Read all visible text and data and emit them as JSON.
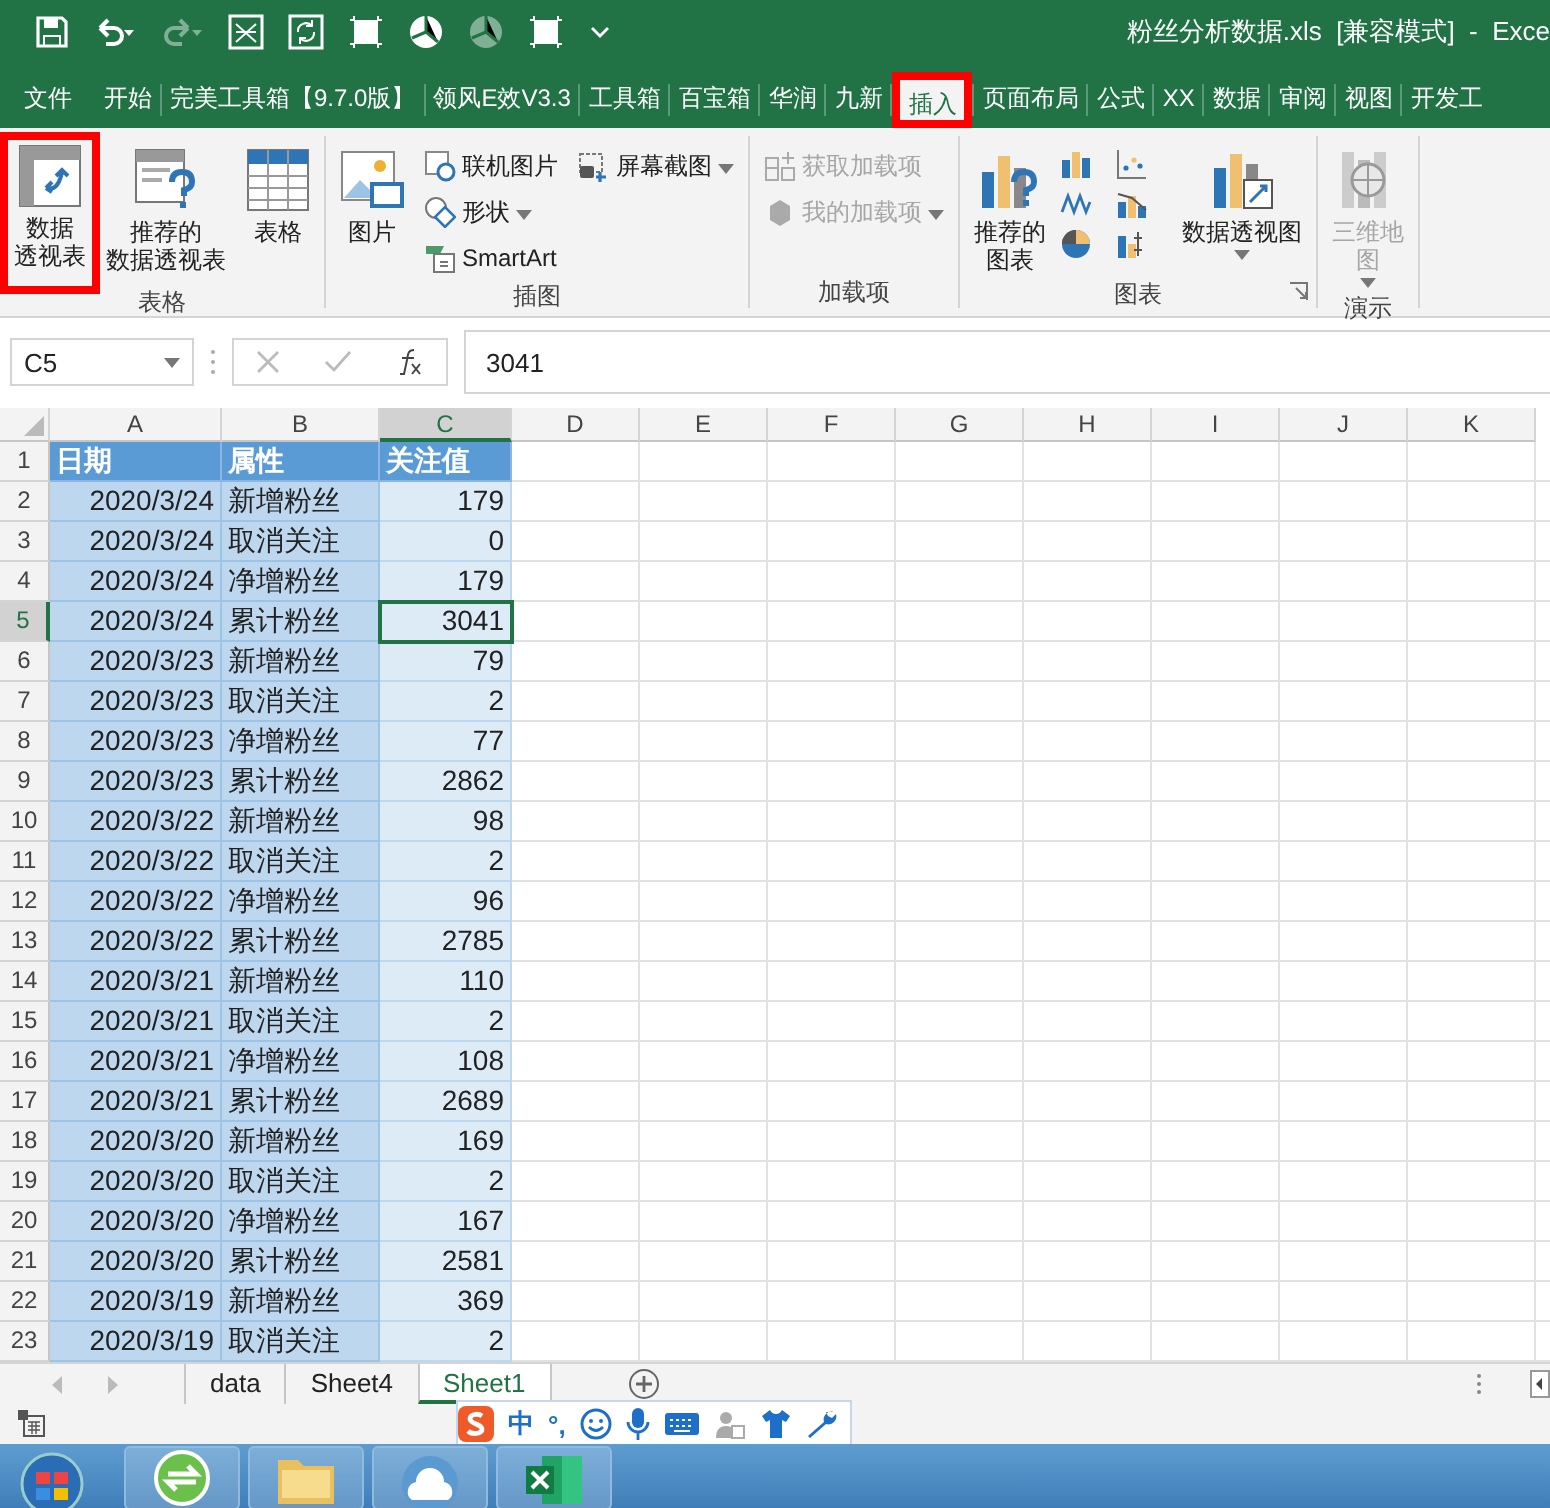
{
  "title_bar": {
    "title": "粉丝分析数据.xls  [兼容模式]  -  Exce"
  },
  "ribbon_tabs": [
    {
      "label": "文件",
      "selected": false,
      "annotated": false
    },
    {
      "label": "开始",
      "selected": false,
      "annotated": false
    },
    {
      "label": "完美工具箱【9.7.0版】",
      "selected": false,
      "annotated": false
    },
    {
      "label": "领风E效V3.3",
      "selected": false,
      "annotated": false
    },
    {
      "label": "工具箱",
      "selected": false,
      "annotated": false
    },
    {
      "label": "百宝箱",
      "selected": false,
      "annotated": false
    },
    {
      "label": "华润",
      "selected": false,
      "annotated": false
    },
    {
      "label": "九新",
      "selected": false,
      "annotated": false
    },
    {
      "label": "插入",
      "selected": true,
      "annotated": true
    },
    {
      "label": "页面布局",
      "selected": false,
      "annotated": false
    },
    {
      "label": "公式",
      "selected": false,
      "annotated": false
    },
    {
      "label": "XX",
      "selected": false,
      "annotated": false
    },
    {
      "label": "数据",
      "selected": false,
      "annotated": false
    },
    {
      "label": "审阅",
      "selected": false,
      "annotated": false
    },
    {
      "label": "视图",
      "selected": false,
      "annotated": false
    },
    {
      "label": "开发工",
      "selected": false,
      "annotated": false
    }
  ],
  "ribbon_groups": [
    {
      "label": "表格",
      "columns": [
        [
          {
            "kind": "large",
            "label_lines": [
              "数据",
              "透视表"
            ],
            "dropdown": false,
            "disabled": false,
            "annotated": true
          }
        ],
        [
          {
            "kind": "large",
            "label_lines": [
              "推荐的",
              "数据透视表"
            ],
            "dropdown": false,
            "disabled": false,
            "annotated": false
          }
        ],
        [
          {
            "kind": "large",
            "label_lines": [
              "表格"
            ],
            "dropdown": false,
            "disabled": false,
            "annotated": false
          }
        ]
      ]
    },
    {
      "label": "插图",
      "columns": [
        [
          {
            "kind": "large",
            "label_lines": [
              "图片"
            ],
            "dropdown": false,
            "disabled": false,
            "annotated": false
          }
        ],
        [
          {
            "kind": "small",
            "label": "联机图片",
            "dropdown": false,
            "disabled": false,
            "annotated": false
          },
          {
            "kind": "small",
            "label": "形状",
            "dropdown": true,
            "disabled": false,
            "annotated": false
          },
          {
            "kind": "small",
            "label": "SmartArt",
            "dropdown": false,
            "disabled": false,
            "annotated": false
          }
        ],
        [
          {
            "kind": "small",
            "label": "屏幕截图",
            "dropdown": true,
            "disabled": false,
            "annotated": false
          }
        ]
      ]
    },
    {
      "label": "加载项",
      "columns": [
        [
          {
            "kind": "small",
            "label": "获取加载项",
            "dropdown": false,
            "disabled": true,
            "annotated": false
          },
          {
            "kind": "small",
            "label": "我的加载项",
            "dropdown": true,
            "disabled": true,
            "annotated": false
          }
        ]
      ]
    },
    {
      "label": "图表",
      "columns": [
        [
          {
            "kind": "large",
            "label_lines": [
              "推荐的",
              "图表"
            ],
            "dropdown": false,
            "disabled": false,
            "annotated": false
          }
        ],
        [
          {
            "kind": "chart_icons"
          }
        ],
        [
          {
            "kind": "large",
            "label_lines": [
              "数据透视图"
            ],
            "dropdown": true,
            "disabled": false,
            "annotated": false
          }
        ]
      ]
    },
    {
      "label": "演示",
      "columns": [
        [
          {
            "kind": "large",
            "label_lines": [
              "三维地",
              "图"
            ],
            "dropdown": true,
            "disabled": true,
            "annotated": false
          }
        ]
      ]
    }
  ],
  "formula_bar": {
    "name_box": "C5",
    "value": "3041"
  },
  "columns": [
    {
      "label": "A",
      "selected": false
    },
    {
      "label": "B",
      "selected": false
    },
    {
      "label": "C",
      "selected": true
    },
    {
      "label": "D",
      "selected": false
    },
    {
      "label": "E",
      "selected": false
    },
    {
      "label": "F",
      "selected": false
    },
    {
      "label": "G",
      "selected": false
    },
    {
      "label": "H",
      "selected": false
    },
    {
      "label": "I",
      "selected": false
    },
    {
      "label": "J",
      "selected": false
    },
    {
      "label": "K",
      "selected": false
    }
  ],
  "rows": [
    {
      "number": "1",
      "kind": "header",
      "selected": false,
      "cells": [
        "日期",
        "属性",
        "关注值"
      ]
    },
    {
      "number": "2",
      "kind": "data",
      "selected": false,
      "cells": [
        "2020/3/24",
        "新增粉丝",
        "179"
      ]
    },
    {
      "number": "3",
      "kind": "data",
      "selected": false,
      "cells": [
        "2020/3/24",
        "取消关注",
        "0"
      ]
    },
    {
      "number": "4",
      "kind": "data",
      "selected": false,
      "cells": [
        "2020/3/24",
        "净增粉丝",
        "179"
      ]
    },
    {
      "number": "5",
      "kind": "data",
      "selected": true,
      "cells": [
        "2020/3/24",
        "累计粉丝",
        "3041"
      ]
    },
    {
      "number": "6",
      "kind": "data",
      "selected": false,
      "cells": [
        "2020/3/23",
        "新增粉丝",
        "79"
      ]
    },
    {
      "number": "7",
      "kind": "data",
      "selected": false,
      "cells": [
        "2020/3/23",
        "取消关注",
        "2"
      ]
    },
    {
      "number": "8",
      "kind": "data",
      "selected": false,
      "cells": [
        "2020/3/23",
        "净增粉丝",
        "77"
      ]
    },
    {
      "number": "9",
      "kind": "data",
      "selected": false,
      "cells": [
        "2020/3/23",
        "累计粉丝",
        "2862"
      ]
    },
    {
      "number": "10",
      "kind": "data",
      "selected": false,
      "cells": [
        "2020/3/22",
        "新增粉丝",
        "98"
      ]
    },
    {
      "number": "11",
      "kind": "data",
      "selected": false,
      "cells": [
        "2020/3/22",
        "取消关注",
        "2"
      ]
    },
    {
      "number": "12",
      "kind": "data",
      "selected": false,
      "cells": [
        "2020/3/22",
        "净增粉丝",
        "96"
      ]
    },
    {
      "number": "13",
      "kind": "data",
      "selected": false,
      "cells": [
        "2020/3/22",
        "累计粉丝",
        "2785"
      ]
    },
    {
      "number": "14",
      "kind": "data",
      "selected": false,
      "cells": [
        "2020/3/21",
        "新增粉丝",
        "110"
      ]
    },
    {
      "number": "15",
      "kind": "data",
      "selected": false,
      "cells": [
        "2020/3/21",
        "取消关注",
        "2"
      ]
    },
    {
      "number": "16",
      "kind": "data",
      "selected": false,
      "cells": [
        "2020/3/21",
        "净增粉丝",
        "108"
      ]
    },
    {
      "number": "17",
      "kind": "data",
      "selected": false,
      "cells": [
        "2020/3/21",
        "累计粉丝",
        "2689"
      ]
    },
    {
      "number": "18",
      "kind": "data",
      "selected": false,
      "cells": [
        "2020/3/20",
        "新增粉丝",
        "169"
      ]
    },
    {
      "number": "19",
      "kind": "data",
      "selected": false,
      "cells": [
        "2020/3/20",
        "取消关注",
        "2"
      ]
    },
    {
      "number": "20",
      "kind": "data",
      "selected": false,
      "cells": [
        "2020/3/20",
        "净增粉丝",
        "167"
      ]
    },
    {
      "number": "21",
      "kind": "data",
      "selected": false,
      "cells": [
        "2020/3/20",
        "累计粉丝",
        "2581"
      ]
    },
    {
      "number": "22",
      "kind": "data",
      "selected": false,
      "cells": [
        "2020/3/19",
        "新增粉丝",
        "369"
      ]
    },
    {
      "number": "23",
      "kind": "data",
      "selected": false,
      "cells": [
        "2020/3/19",
        "取消关注",
        "2"
      ]
    }
  ],
  "sheet_tabs": [
    {
      "label": "data",
      "selected": false
    },
    {
      "label": "Sheet4",
      "selected": false
    },
    {
      "label": "Sheet1",
      "selected": true
    }
  ],
  "ime_bar": {
    "labels": [
      "中",
      "°,"
    ]
  }
}
